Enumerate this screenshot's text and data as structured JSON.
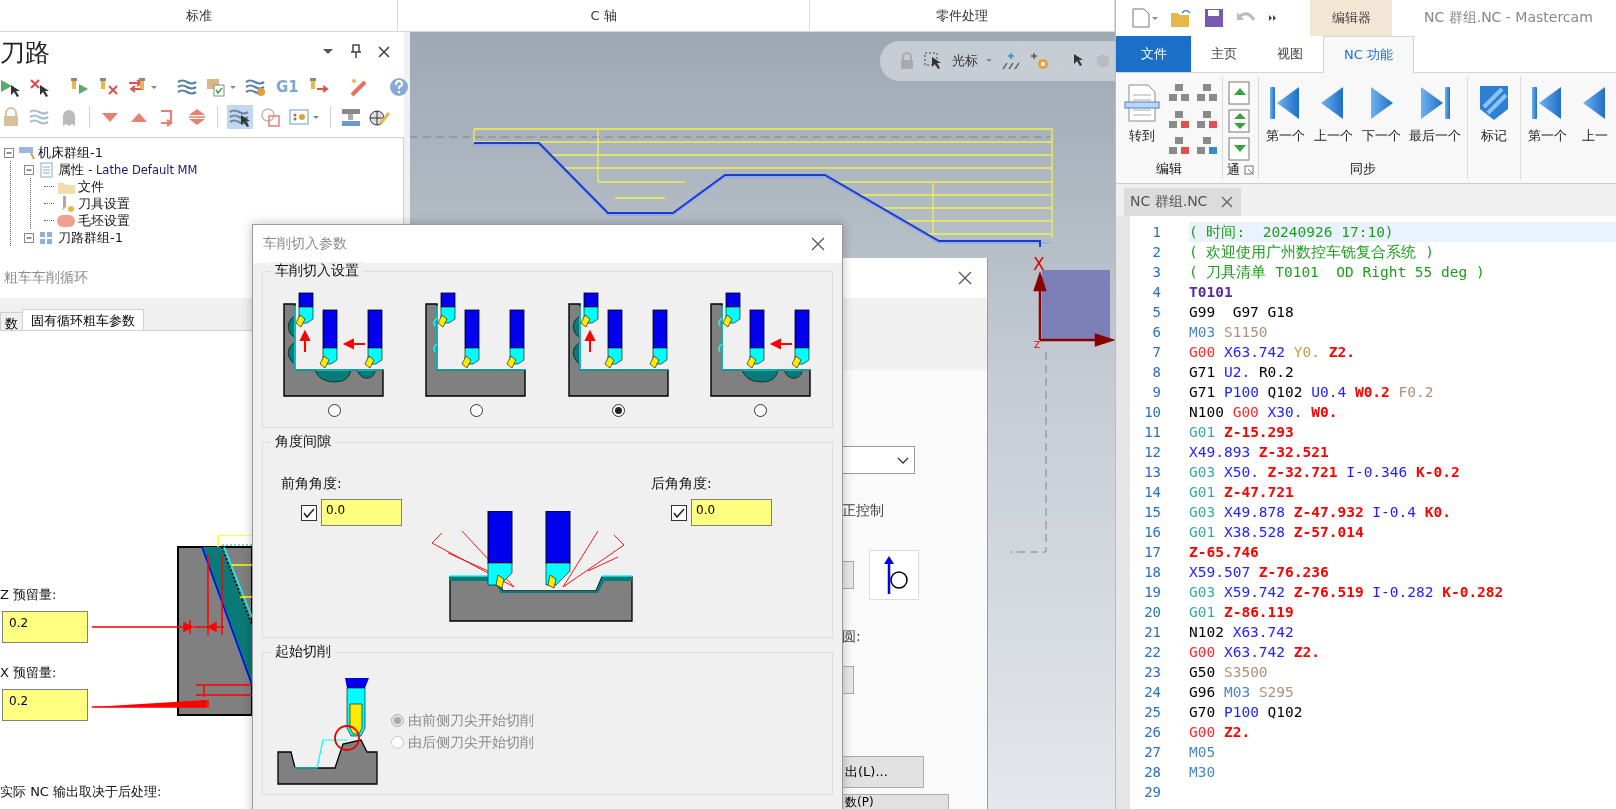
{
  "top_tabs": [
    {
      "label": "标准"
    },
    {
      "label": "C 轴"
    },
    {
      "label": "零件处理"
    }
  ],
  "toolpath_panel": {
    "title": "刀路",
    "g1_label": "G1",
    "select_toggle": {
      "on": true
    },
    "tree": [
      {
        "label": "机床群组-1",
        "kind": "machine",
        "expanded": true,
        "children": [
          {
            "label": "属性",
            "sublabel": "- Lathe Default MM",
            "kind": "properties",
            "expanded": true,
            "children": [
              {
                "label": "文件",
                "kind": "folder"
              },
              {
                "label": "刀具设置",
                "kind": "tool"
              },
              {
                "label": "毛坯设置",
                "kind": "stock"
              }
            ]
          },
          {
            "label": "刀路群组-1",
            "kind": "group",
            "expanded": true
          }
        ]
      }
    ]
  },
  "viewport": {
    "mode_label": "光标",
    "axis_labels": [
      "X",
      "Z"
    ]
  },
  "lathe_cycle_dialog": {
    "title": "粗车车削循环",
    "tabs": [
      {
        "label": "数",
        "selected": false
      },
      {
        "label": "固有循环粗车参数",
        "selected": true
      }
    ],
    "z_stock": {
      "label": "Z 预留量:",
      "value": "0.2"
    },
    "x_stock": {
      "label": "X 预留量:",
      "value": "0.2"
    },
    "note": "实际 NC 输出取决于后处理:",
    "labels": [
      "正控制",
      "圆:"
    ],
    "buttons": [
      "出(L)...",
      "数(P)"
    ]
  },
  "entry_dialog": {
    "title": "车削切入参数",
    "entry_title": "车削切入设置",
    "entry_options": [
      {
        "selected": false
      },
      {
        "selected": false
      },
      {
        "selected": true
      },
      {
        "selected": false
      }
    ],
    "clearance_title": "角度间隙",
    "front_angle": {
      "label": "前角角度:",
      "checked": true,
      "value": "0.0"
    },
    "back_angle": {
      "label": "后角角度:",
      "checked": true,
      "value": "0.0"
    },
    "start_title": "起始切削",
    "start_options": [
      {
        "label": "由前侧刀尖开始切削",
        "selected": true,
        "disabled": true
      },
      {
        "label": "由后侧刀尖开始切削",
        "selected": false,
        "disabled": true
      }
    ]
  },
  "editor": {
    "context_tab": "编辑器",
    "title": "NC 群组.NC - Mastercam",
    "tabs": [
      {
        "label": "文件",
        "kind": "file",
        "selected": false
      },
      {
        "label": "主页",
        "kind": "tab",
        "selected": false
      },
      {
        "label": "视图",
        "kind": "tab",
        "selected": false
      },
      {
        "label": "NC 功能",
        "kind": "tab",
        "selected": true
      }
    ],
    "groups": [
      {
        "kind": "edit",
        "label": "编辑",
        "buttons": [
          {
            "label": "转到",
            "kind": "goto"
          }
        ]
      },
      {
        "kind": "channel",
        "label": "通"
      },
      {
        "kind": "sync",
        "label": "同步",
        "buttons": [
          {
            "label": "第一个",
            "kind": "first"
          },
          {
            "label": "上一个",
            "kind": "prev"
          },
          {
            "label": "下一个",
            "kind": "next"
          },
          {
            "label": "最后一个",
            "kind": "last"
          }
        ]
      },
      {
        "kind": "sync",
        "buttons": [
          {
            "label": "标记",
            "kind": "mark"
          }
        ]
      },
      {
        "kind": "sync",
        "buttons": [
          {
            "label": "第一个",
            "kind": "first"
          },
          {
            "label": "上一",
            "kind": "prev"
          }
        ]
      }
    ],
    "document_tab": "NC 群组.NC",
    "lines": [
      {
        "n": "1",
        "selected": true,
        "tokens": [
          {
            "text": "( 时间:  20240926 17:10)",
            "kind": "comment"
          }
        ]
      },
      {
        "n": "2",
        "selected": false,
        "tokens": [
          {
            "text": "( 欢迎使用广州数控车铣复合系统 )",
            "kind": "comment"
          }
        ]
      },
      {
        "n": "3",
        "selected": false,
        "tokens": [
          {
            "text": "( 刀具清单 T0101  OD Right 55 deg )",
            "kind": "comment"
          }
        ]
      },
      {
        "n": "4",
        "selected": false,
        "tokens": [
          {
            "text": "T0101",
            "kind": "tool"
          }
        ]
      },
      {
        "n": "5",
        "selected": false,
        "tokens": [
          {
            "text": "G99 ",
            "kind": "plain"
          },
          {
            "text": "G97",
            "kind": "plain"
          },
          {
            "text": "G18",
            "kind": "plain"
          }
        ]
      },
      {
        "n": "6",
        "selected": false,
        "tokens": [
          {
            "text": "M03",
            "kind": "m"
          },
          {
            "text": "S1150",
            "kind": "spindle"
          }
        ]
      },
      {
        "n": "7",
        "selected": false,
        "tokens": [
          {
            "text": "G00",
            "kind": "rapid"
          },
          {
            "text": "X63.742",
            "kind": "axis"
          },
          {
            "text": "Y0.",
            "kind": "yaxis"
          },
          {
            "text": "Z2.",
            "kind": "zaxis"
          }
        ]
      },
      {
        "n": "8",
        "selected": false,
        "tokens": [
          {
            "text": "G71",
            "kind": "plain"
          },
          {
            "text": "U2.",
            "kind": "axis"
          },
          {
            "text": "R0.2",
            "kind": "plain"
          }
        ]
      },
      {
        "n": "9",
        "selected": false,
        "tokens": [
          {
            "text": "G71",
            "kind": "plain"
          },
          {
            "text": "P100",
            "kind": "axis"
          },
          {
            "text": "Q102",
            "kind": "plain"
          },
          {
            "text": "U0.4",
            "kind": "axis"
          },
          {
            "text": "W0.2",
            "kind": "zaxis"
          },
          {
            "text": "F0.2",
            "kind": "spindle"
          }
        ]
      },
      {
        "n": "10",
        "selected": false,
        "tokens": [
          {
            "text": "N100",
            "kind": "plain"
          },
          {
            "text": "G00",
            "kind": "rapid"
          },
          {
            "text": "X30.",
            "kind": "axis"
          },
          {
            "text": "W0.",
            "kind": "zaxis"
          }
        ]
      },
      {
        "n": "11",
        "selected": false,
        "tokens": [
          {
            "text": "G01",
            "kind": "motion"
          },
          {
            "text": "Z-15.293",
            "kind": "zaxis"
          }
        ]
      },
      {
        "n": "12",
        "selected": false,
        "tokens": [
          {
            "text": "X49.893",
            "kind": "axis"
          },
          {
            "text": "Z-32.521",
            "kind": "zaxis"
          }
        ]
      },
      {
        "n": "13",
        "selected": false,
        "tokens": [
          {
            "text": "G03",
            "kind": "motion"
          },
          {
            "text": "X50.",
            "kind": "axis"
          },
          {
            "text": "Z-32.721",
            "kind": "zaxis"
          },
          {
            "text": "I-0.346",
            "kind": "axis"
          },
          {
            "text": "K-0.2",
            "kind": "zaxis"
          }
        ]
      },
      {
        "n": "14",
        "selected": false,
        "tokens": [
          {
            "text": "G01",
            "kind": "motion"
          },
          {
            "text": "Z-47.721",
            "kind": "zaxis"
          }
        ]
      },
      {
        "n": "15",
        "selected": false,
        "tokens": [
          {
            "text": "G03",
            "kind": "motion"
          },
          {
            "text": "X49.878",
            "kind": "axis"
          },
          {
            "text": "Z-47.932",
            "kind": "zaxis"
          },
          {
            "text": "I-0.4",
            "kind": "axis"
          },
          {
            "text": "K0.",
            "kind": "zaxis"
          }
        ]
      },
      {
        "n": "16",
        "selected": false,
        "tokens": [
          {
            "text": "G01",
            "kind": "motion"
          },
          {
            "text": "X38.528",
            "kind": "axis"
          },
          {
            "text": "Z-57.014",
            "kind": "zaxis"
          }
        ]
      },
      {
        "n": "17",
        "selected": false,
        "tokens": [
          {
            "text": "Z-65.746",
            "kind": "zaxis"
          }
        ]
      },
      {
        "n": "18",
        "selected": false,
        "tokens": [
          {
            "text": "X59.507",
            "kind": "axis"
          },
          {
            "text": "Z-76.236",
            "kind": "zaxis"
          }
        ]
      },
      {
        "n": "19",
        "selected": false,
        "tokens": [
          {
            "text": "G03",
            "kind": "motion"
          },
          {
            "text": "X59.742",
            "kind": "axis"
          },
          {
            "text": "Z-76.519",
            "kind": "zaxis"
          },
          {
            "text": "I-0.282",
            "kind": "axis"
          },
          {
            "text": "K-0.282",
            "kind": "zaxis"
          }
        ]
      },
      {
        "n": "20",
        "selected": false,
        "tokens": [
          {
            "text": "G01",
            "kind": "motion"
          },
          {
            "text": "Z-86.119",
            "kind": "zaxis"
          }
        ]
      },
      {
        "n": "21",
        "selected": false,
        "tokens": [
          {
            "text": "N102",
            "kind": "plain"
          },
          {
            "text": "X63.742",
            "kind": "axis"
          }
        ]
      },
      {
        "n": "22",
        "selected": false,
        "tokens": [
          {
            "text": "G00",
            "kind": "rapid"
          },
          {
            "text": "X63.742",
            "kind": "axis"
          },
          {
            "text": "Z2.",
            "kind": "zaxis"
          }
        ]
      },
      {
        "n": "23",
        "selected": false,
        "tokens": [
          {
            "text": "G50",
            "kind": "plain"
          },
          {
            "text": "S3500",
            "kind": "spindle"
          }
        ]
      },
      {
        "n": "24",
        "selected": false,
        "tokens": [
          {
            "text": "G96",
            "kind": "plain"
          },
          {
            "text": "M03",
            "kind": "m"
          },
          {
            "text": "S295",
            "kind": "spindle"
          }
        ]
      },
      {
        "n": "25",
        "selected": false,
        "tokens": [
          {
            "text": "G70",
            "kind": "plain"
          },
          {
            "text": "P100",
            "kind": "axis"
          },
          {
            "text": "Q102",
            "kind": "plain"
          }
        ]
      },
      {
        "n": "26",
        "selected": false,
        "tokens": [
          {
            "text": "G00",
            "kind": "rapid"
          },
          {
            "text": "Z2.",
            "kind": "zaxis"
          }
        ]
      },
      {
        "n": "27",
        "selected": false,
        "tokens": [
          {
            "text": "M05",
            "kind": "m"
          }
        ]
      },
      {
        "n": "28",
        "selected": false,
        "tokens": [
          {
            "text": "M30",
            "kind": "m"
          }
        ]
      },
      {
        "n": "29",
        "selected": false
      }
    ]
  }
}
